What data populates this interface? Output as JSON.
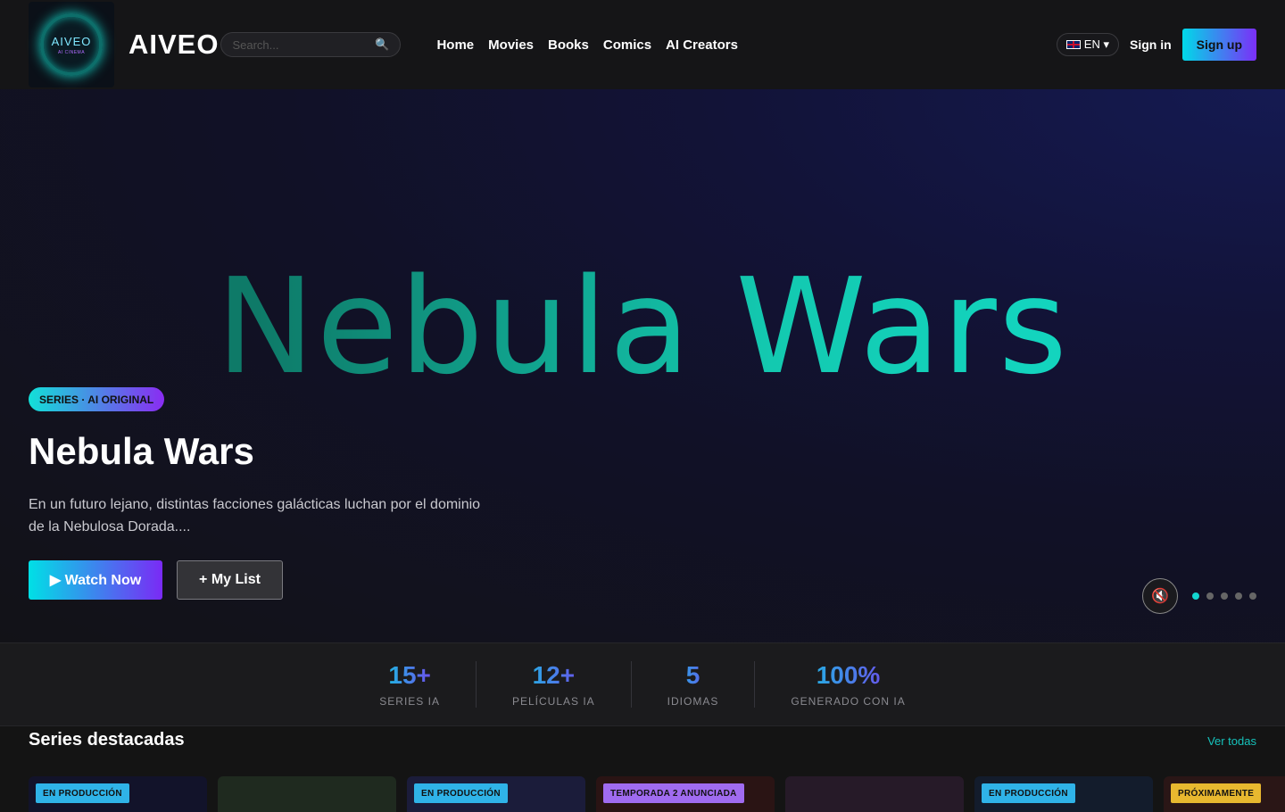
{
  "header": {
    "logo_text": "AIVEO",
    "logo_subtext": "AI CINEMA",
    "brand": "AIVEO",
    "search_placeholder": "Search...",
    "search_icon": "search-icon",
    "nav": [
      "Home",
      "Movies",
      "Books",
      "Comics",
      "AI Creators"
    ],
    "language": "EN ▾",
    "sign_in": "Sign in",
    "sign_up": "Sign up"
  },
  "hero": {
    "art_title": "Nebula Wars",
    "badge": "SERIES · AI ORIGINAL",
    "title": "Nebula Wars",
    "description": "En un futuro lejano, distintas facciones galácticas luchan por el dominio de la Nebulosa Dorada....",
    "watch_label": "▶ Watch Now",
    "mylist_label": "+ My List",
    "mute_icon": "🔇",
    "slide_count": 5,
    "active_slide": 1
  },
  "stats": [
    {
      "value": "15+",
      "label": "SERIES IA"
    },
    {
      "value": "12+",
      "label": "PELÍCULAS IA"
    },
    {
      "value": "5",
      "label": "IDIOMAS"
    },
    {
      "value": "100%",
      "label": "GENERADO CON IA"
    }
  ],
  "featured": {
    "title": "Series destacadas",
    "see_all": "Ver todas",
    "cards": [
      {
        "tag": "EN PRODUCCIÓN",
        "tag_color": "#2fb3e8",
        "bg": "#12132a"
      },
      {
        "tag": "",
        "tag_color": "",
        "bg": "#1f2a1f"
      },
      {
        "tag": "EN PRODUCCIÓN",
        "tag_color": "#2fb3e8",
        "bg": "#1b1c3a"
      },
      {
        "tag": "TEMPORADA 2 ANUNCIADA",
        "tag_color": "#a06bf0",
        "bg": "#2a1414"
      },
      {
        "tag": "",
        "tag_color": "",
        "bg": "#261a28"
      },
      {
        "tag": "EN PRODUCCIÓN",
        "tag_color": "#2fb3e8",
        "bg": "#131c2c"
      },
      {
        "tag": "PRÓXIMAMENTE",
        "tag_color": "#e8b82f",
        "bg": "#2a1616"
      }
    ]
  }
}
